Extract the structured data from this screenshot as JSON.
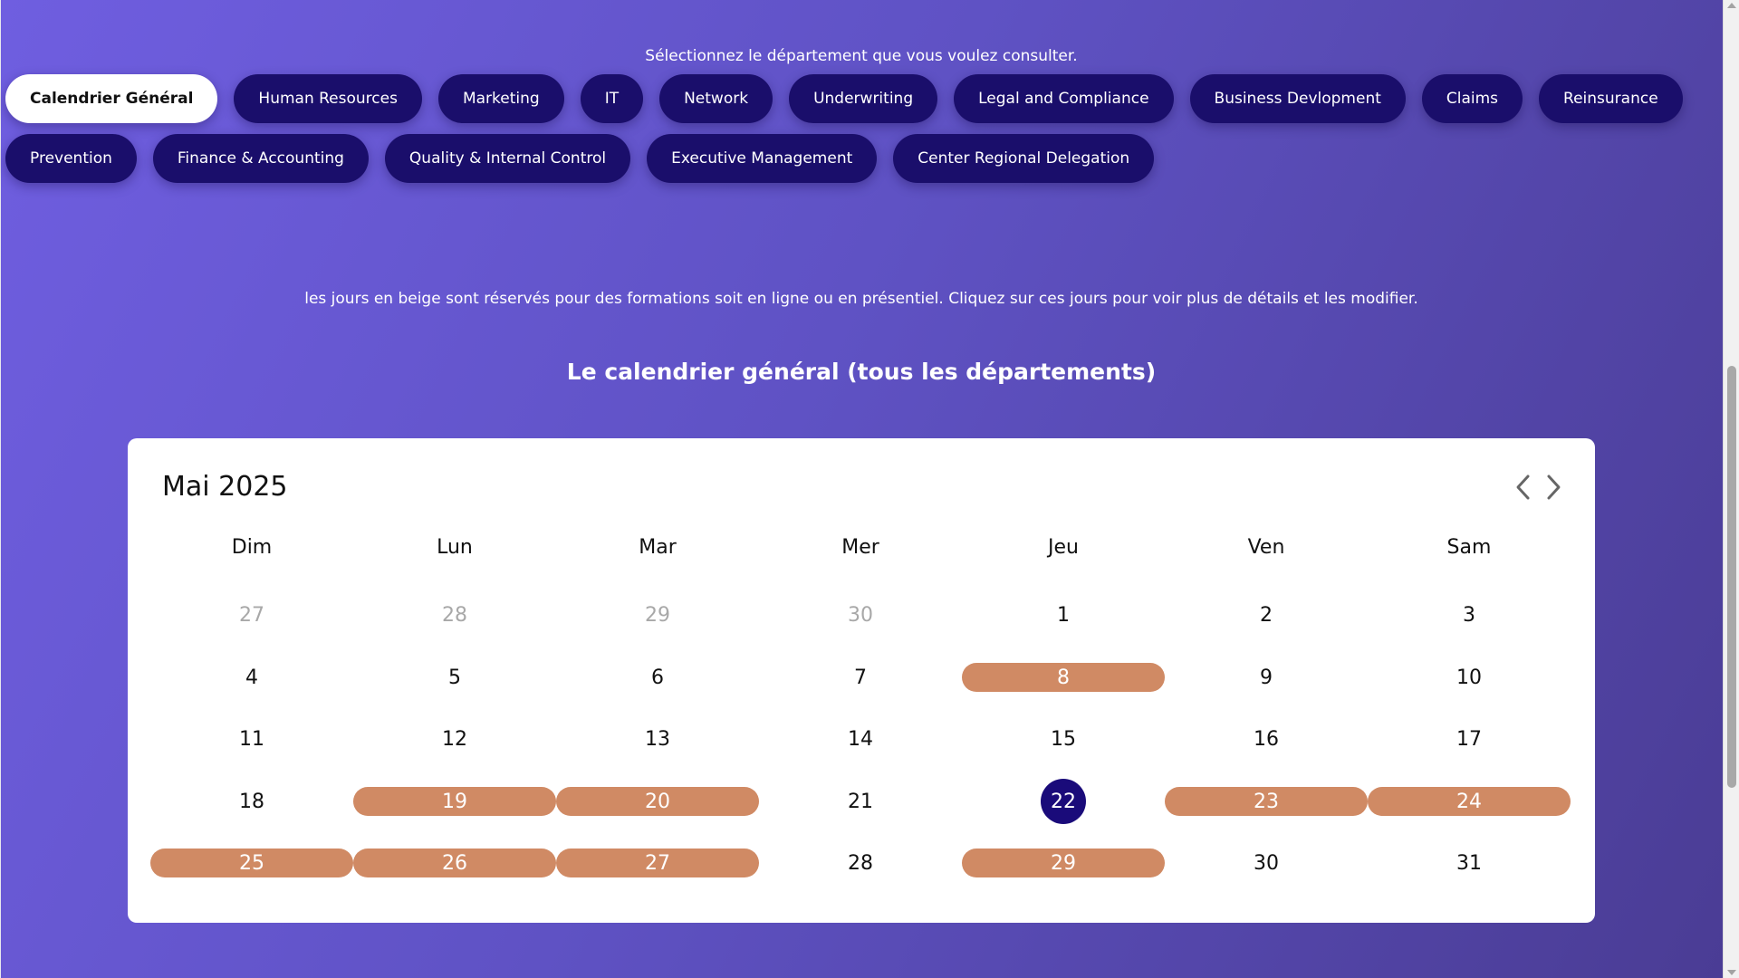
{
  "prompt": "Sélectionnez le département que vous voulez consulter.",
  "departments_row1": [
    "Calendrier Général",
    "Human Resources",
    "Marketing",
    "IT",
    "Network",
    "Underwriting",
    "Legal and Compliance",
    "Business Devlopment",
    "Claims",
    "Reinsurance"
  ],
  "departments_row2": [
    "Prevention",
    "Finance & Accounting",
    "Quality & Internal Control",
    "Executive Management",
    "Center Regional Delegation"
  ],
  "active_department": "Calendrier Général",
  "info": "les jours en beige sont réservés pour des formations soit en ligne ou en présentiel. Cliquez sur ces jours pour voir plus de détails et les modifier.",
  "calendar_heading": "Le calendrier général (tous les départements)",
  "calendar": {
    "month_label": "Mai 2025",
    "weekdays": [
      "Dim",
      "Lun",
      "Mar",
      "Mer",
      "Jeu",
      "Ven",
      "Sam"
    ],
    "weeks": [
      [
        {
          "d": "27",
          "other": true
        },
        {
          "d": "28",
          "other": true
        },
        {
          "d": "29",
          "other": true
        },
        {
          "d": "30",
          "other": true
        },
        {
          "d": "1"
        },
        {
          "d": "2"
        },
        {
          "d": "3"
        }
      ],
      [
        {
          "d": "4"
        },
        {
          "d": "5"
        },
        {
          "d": "6"
        },
        {
          "d": "7"
        },
        {
          "d": "8",
          "booked": true
        },
        {
          "d": "9"
        },
        {
          "d": "10"
        }
      ],
      [
        {
          "d": "11"
        },
        {
          "d": "12"
        },
        {
          "d": "13"
        },
        {
          "d": "14"
        },
        {
          "d": "15"
        },
        {
          "d": "16"
        },
        {
          "d": "17"
        }
      ],
      [
        {
          "d": "18"
        },
        {
          "d": "19",
          "booked": true
        },
        {
          "d": "20",
          "booked": true
        },
        {
          "d": "21"
        },
        {
          "d": "22",
          "today": true
        },
        {
          "d": "23",
          "booked": true
        },
        {
          "d": "24",
          "booked": true
        }
      ],
      [
        {
          "d": "25",
          "booked": true
        },
        {
          "d": "26",
          "booked": true
        },
        {
          "d": "27",
          "booked": true
        },
        {
          "d": "28"
        },
        {
          "d": "29",
          "booked": true
        },
        {
          "d": "30"
        },
        {
          "d": "31"
        }
      ]
    ]
  },
  "colors": {
    "booked": "#d08a64",
    "today": "#1a0b7a",
    "pill": "#1a0e6b"
  },
  "icons": {
    "prev": "chevron-left-icon",
    "next": "chevron-right-icon"
  }
}
